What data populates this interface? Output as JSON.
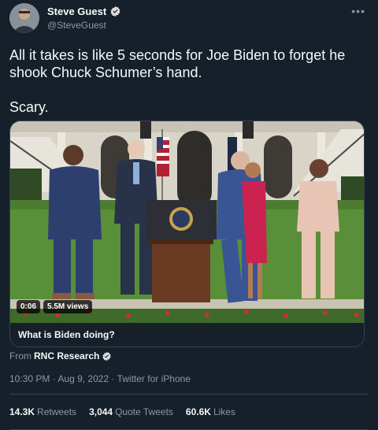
{
  "author": {
    "name": "Steve Guest",
    "handle": "@SteveGuest"
  },
  "tweet": {
    "text": "All it takes is like 5 seconds for Joe Biden to forget he shook Chuck Schumer’s hand.\n\nScary."
  },
  "media": {
    "time": "0:06",
    "views": "5.5M views",
    "caption": "What is Biden doing?"
  },
  "attribution": {
    "prefix": "From",
    "source": "RNC Research"
  },
  "meta": {
    "time": "10:30 PM",
    "date": "Aug 9, 2022",
    "client": "Twitter for iPhone",
    "separator": "·"
  },
  "stats": {
    "retweets_value": "14.3K",
    "retweets_label": "Retweets",
    "quotes_value": "3,044",
    "quotes_label": "Quote Tweets",
    "likes_value": "60.6K",
    "likes_label": "Likes"
  },
  "colors": {
    "background": "#15202b",
    "verified": "#d9d9d9",
    "border": "#38444d",
    "muted": "#8b98a5"
  }
}
